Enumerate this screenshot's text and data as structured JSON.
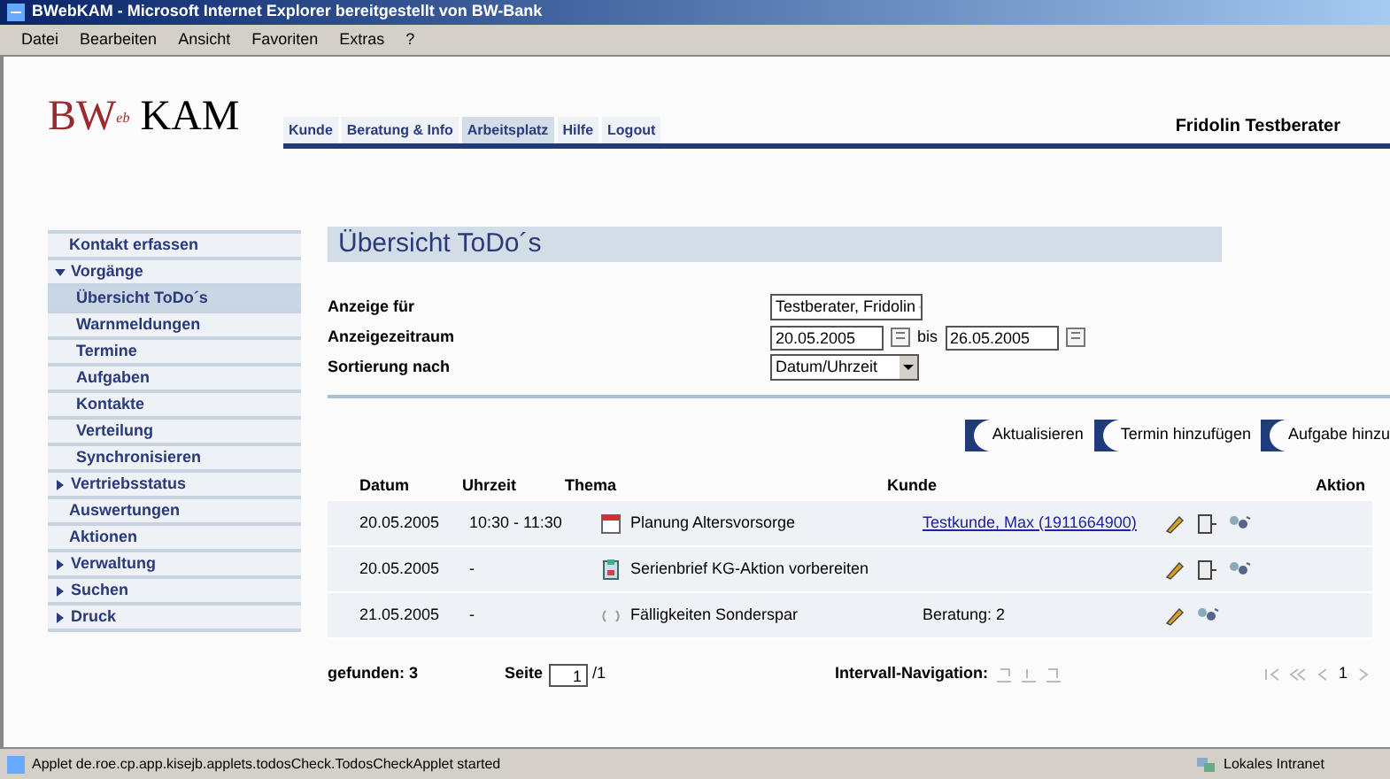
{
  "window": {
    "title": "BWebKAM - Microsoft Internet Explorer bereitgestellt von BW-Bank"
  },
  "menu": [
    "Datei",
    "Bearbeiten",
    "Ansicht",
    "Favoriten",
    "Extras",
    "?"
  ],
  "logo": {
    "left": "BW",
    "sup": "eb",
    "right": "KAM"
  },
  "tabs": [
    {
      "label": "Kunde",
      "selected": false
    },
    {
      "label": "Beratung & Info",
      "selected": false
    },
    {
      "label": "Arbeitsplatz",
      "selected": true
    },
    {
      "label": "Hilfe",
      "selected": false
    },
    {
      "label": "Logout",
      "selected": false
    }
  ],
  "user": "Fridolin Testberater",
  "sidebar": {
    "items": [
      {
        "label": "Kontakt erfassen",
        "selected": false
      },
      {
        "label": "Vorgänge",
        "selected": false,
        "expanded": true,
        "children": [
          {
            "label": "Übersicht ToDo´s",
            "selected": true
          },
          {
            "label": "Warnmeldungen",
            "selected": false
          },
          {
            "label": "Termine",
            "selected": false
          },
          {
            "label": "Aufgaben",
            "selected": false
          },
          {
            "label": "Kontakte",
            "selected": false
          },
          {
            "label": "Verteilung",
            "selected": false
          },
          {
            "label": "Synchronisieren",
            "selected": false
          }
        ]
      },
      {
        "label": "Vertriebsstatus",
        "selected": false,
        "expanded": false
      },
      {
        "label": "Auswertungen",
        "selected": false
      },
      {
        "label": "Aktionen",
        "selected": false
      },
      {
        "label": "Verwaltung",
        "selected": false,
        "expanded": false
      },
      {
        "label": "Suchen",
        "selected": false,
        "expanded": false
      },
      {
        "label": "Druck",
        "selected": false,
        "expanded": false
      }
    ]
  },
  "page_title": "Übersicht ToDo´s",
  "form": {
    "anzeige_fuer": {
      "label": "Anzeige für",
      "value": "Testberater, Fridolin"
    },
    "zeitraum": {
      "label": "Anzeigezeitraum",
      "from": "20.05.2005",
      "sep": "bis",
      "to": "26.05.2005"
    },
    "sortierung": {
      "label": "Sortierung nach",
      "value": "Datum/Uhrzeit"
    }
  },
  "buttons": [
    "Aktualisieren",
    "Termin hinzufügen",
    "Aufgabe hinzu"
  ],
  "table": {
    "columns": [
      "Datum",
      "Uhrzeit",
      "Thema",
      "Kunde",
      "Aktion"
    ],
    "rows": [
      {
        "datum": "20.05.2005",
        "uhrzeit": "10:30 - 11:30",
        "thema": {
          "kind": "appointment",
          "text": "Planung Altersvorsorge"
        },
        "kunde": {
          "kind": "link",
          "text": "Testkunde, Max (1911664900)"
        },
        "actions": [
          {
            "kind": "edit"
          },
          {
            "kind": "delete"
          },
          {
            "kind": "assign"
          }
        ]
      },
      {
        "datum": "20.05.2005",
        "uhrzeit": "-",
        "thema": {
          "kind": "task",
          "text": "Serienbrief KG-Aktion vorbereiten"
        },
        "actions": [
          {
            "kind": "edit"
          },
          {
            "kind": "delete"
          },
          {
            "kind": "assign"
          }
        ]
      },
      {
        "datum": "21.05.2005",
        "uhrzeit": "-",
        "thema": {
          "kind": "recurring",
          "text": "Fälligkeiten Sonderspar"
        },
        "kunde": {
          "kind": "text",
          "text": "Beratung: 2"
        },
        "actions": [
          {
            "kind": "edit"
          },
          {
            "kind": "assign"
          }
        ]
      }
    ]
  },
  "footer": {
    "found": "gefunden: 3",
    "page_label": "Seite",
    "page_value": "1",
    "page_total": "/1",
    "interval_label": "Intervall-Navigation:",
    "pager_current": "1"
  },
  "status_bar": {
    "text": "Applet de.roe.cp.app.kisejb.applets.todosCheck.TodosCheckApplet started",
    "zone": "Lokales Intranet"
  }
}
